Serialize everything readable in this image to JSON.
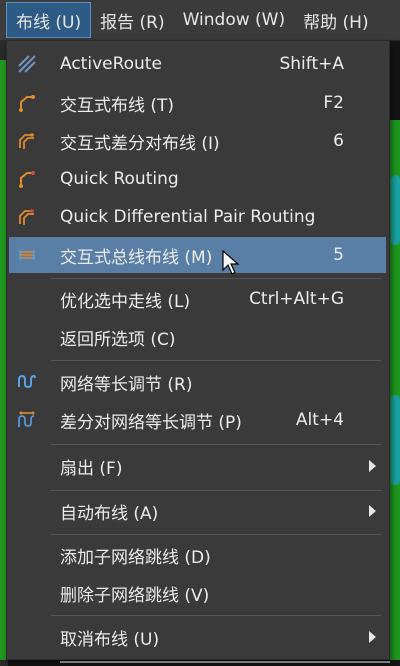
{
  "menubar": {
    "items": [
      {
        "label": "布线 (U)",
        "active": true
      },
      {
        "label": "报告 (R)"
      },
      {
        "label": "Window (W)"
      },
      {
        "label": "帮助 (H)"
      }
    ]
  },
  "menu": {
    "items": [
      {
        "label": "ActiveRoute",
        "shortcut": "Shift+A",
        "icon": "active-route-icon"
      },
      {
        "label": "交互式布线 (T)",
        "shortcut": "F2",
        "icon": "interactive-routing-icon"
      },
      {
        "label": "交互式差分对布线 (I)",
        "shortcut": "6",
        "icon": "diff-pair-routing-icon"
      },
      {
        "label": "Quick Routing",
        "shortcut": "",
        "icon": "quick-routing-icon"
      },
      {
        "label": "Quick Differential Pair Routing",
        "shortcut": "",
        "icon": "quick-diff-pair-icon"
      },
      {
        "label": "交互式总线布线 (M)",
        "shortcut": "5",
        "icon": "bus-routing-icon",
        "highlighted": true
      },
      {
        "label": "优化选中走线 (L)",
        "shortcut": "Ctrl+Alt+G"
      },
      {
        "label": "返回所选项 (C)",
        "shortcut": ""
      },
      {
        "label": "网络等长调节 (R)",
        "shortcut": "",
        "icon": "length-tuning-icon"
      },
      {
        "label": "差分对网络等长调节 (P)",
        "shortcut": "Alt+4",
        "icon": "diff-length-tuning-icon"
      },
      {
        "label": "扇出 (F)",
        "submenu": true
      },
      {
        "label": "自动布线 (A)",
        "submenu": true
      },
      {
        "label": "添加子网络跳线 (D)"
      },
      {
        "label": "删除子网络跳线 (V)"
      },
      {
        "label": "取消布线 (U)",
        "submenu": true
      }
    ]
  },
  "colors": {
    "menu_bg": "#3a3a3a",
    "highlight": "#5a7fa6",
    "active_menubar": "#2e5b86",
    "icon_orange": "#e08a2a",
    "icon_blue": "#5aa0e8"
  }
}
